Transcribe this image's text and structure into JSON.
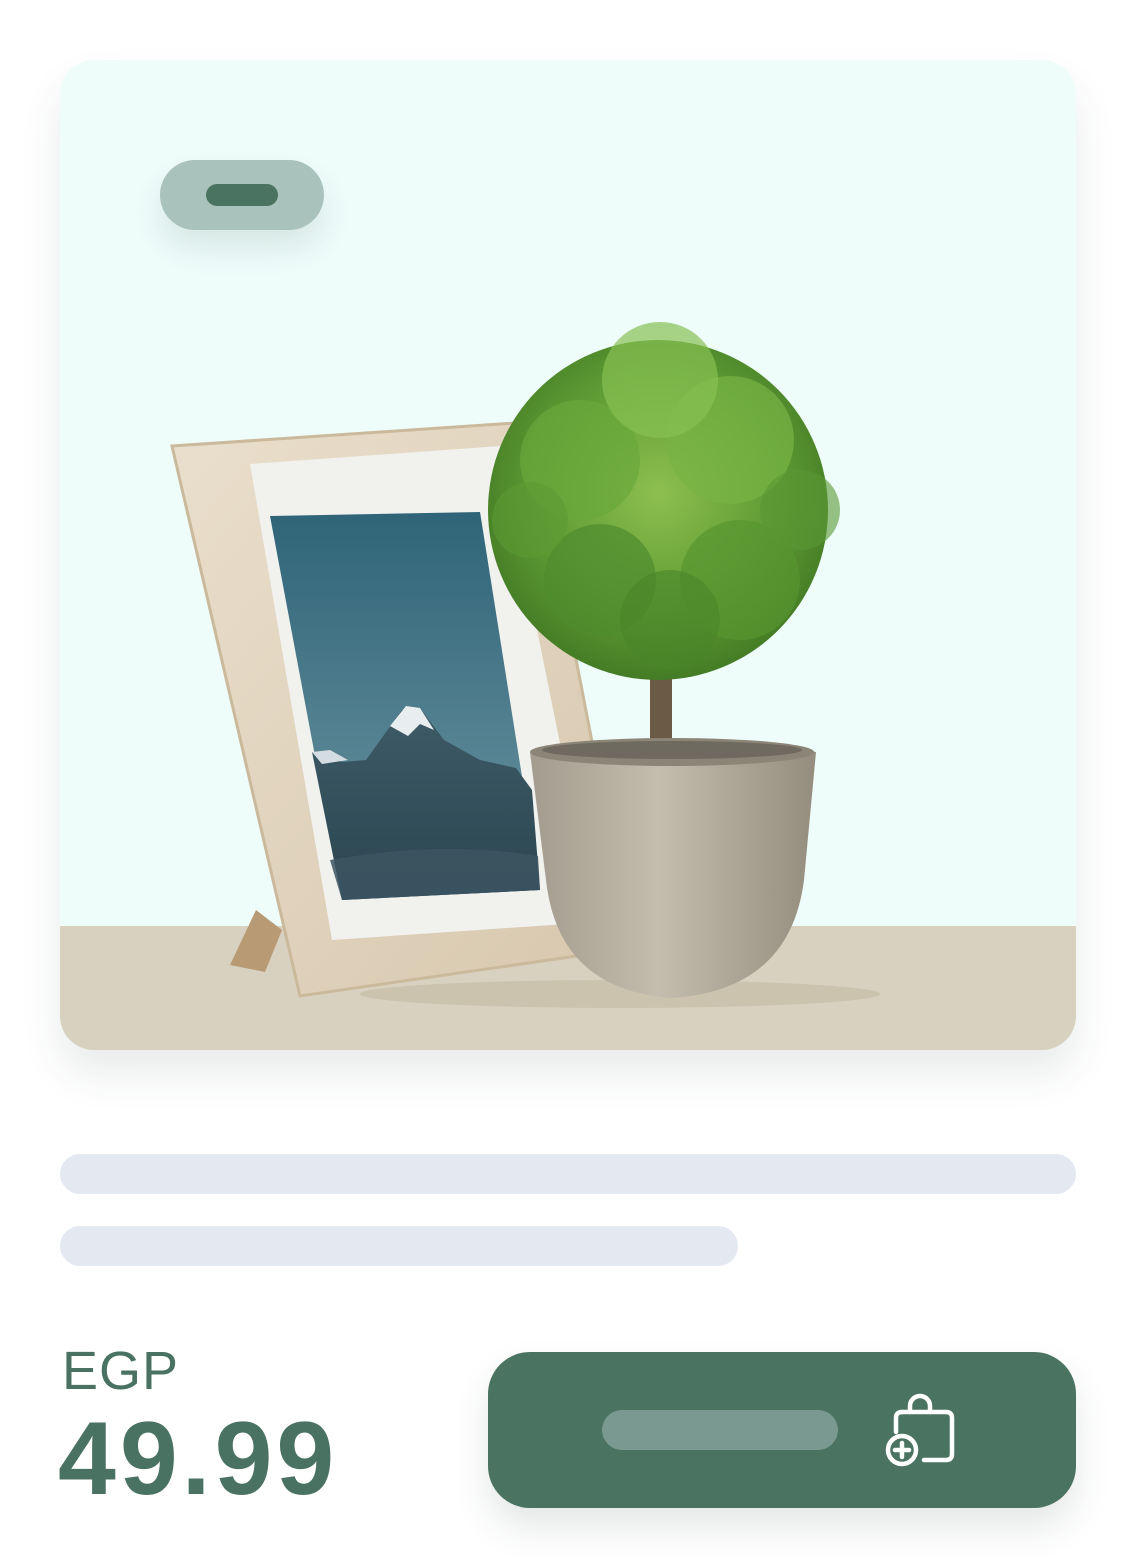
{
  "product": {
    "image": {
      "subject": "potted-plant-with-photo-frame"
    },
    "badge": {
      "text": ""
    },
    "title_lines": [
      "",
      ""
    ],
    "price": {
      "currency": "EGP",
      "amount": "49.99"
    },
    "add_to_cart": {
      "label": "",
      "icon": "shopping-bag-plus-icon"
    }
  },
  "colors": {
    "accent": "#4b7361",
    "badge": "#a9c2bb",
    "skeleton": "#e3e8f1",
    "card_bg": "#eefcfa",
    "floor": "#d9d1bf"
  }
}
